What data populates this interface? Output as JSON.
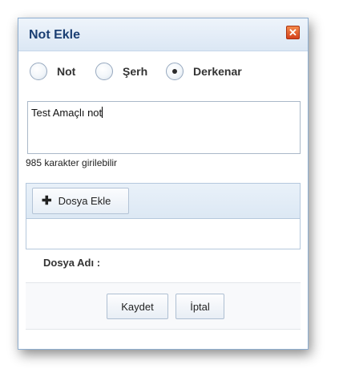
{
  "dialog": {
    "title": "Not Ekle",
    "close_symbol": "✕"
  },
  "radios": [
    {
      "label": "Not",
      "checked": false
    },
    {
      "label": "Şerh",
      "checked": false
    },
    {
      "label": "Derkenar",
      "checked": true
    }
  ],
  "note": {
    "value": "Test Amaçlı not"
  },
  "char_counter": "985 karakter girilebilir",
  "upload": {
    "add_file_label": "Dosya Ekle",
    "add_icon": "plus-icon",
    "file_name_label": "Dosya Adı :"
  },
  "footer": {
    "save_label": "Kaydet",
    "cancel_label": "İptal"
  },
  "colors": {
    "title_text": "#1b3f73",
    "close_button": "#e0521f",
    "panel_border": "#8eaed0"
  }
}
